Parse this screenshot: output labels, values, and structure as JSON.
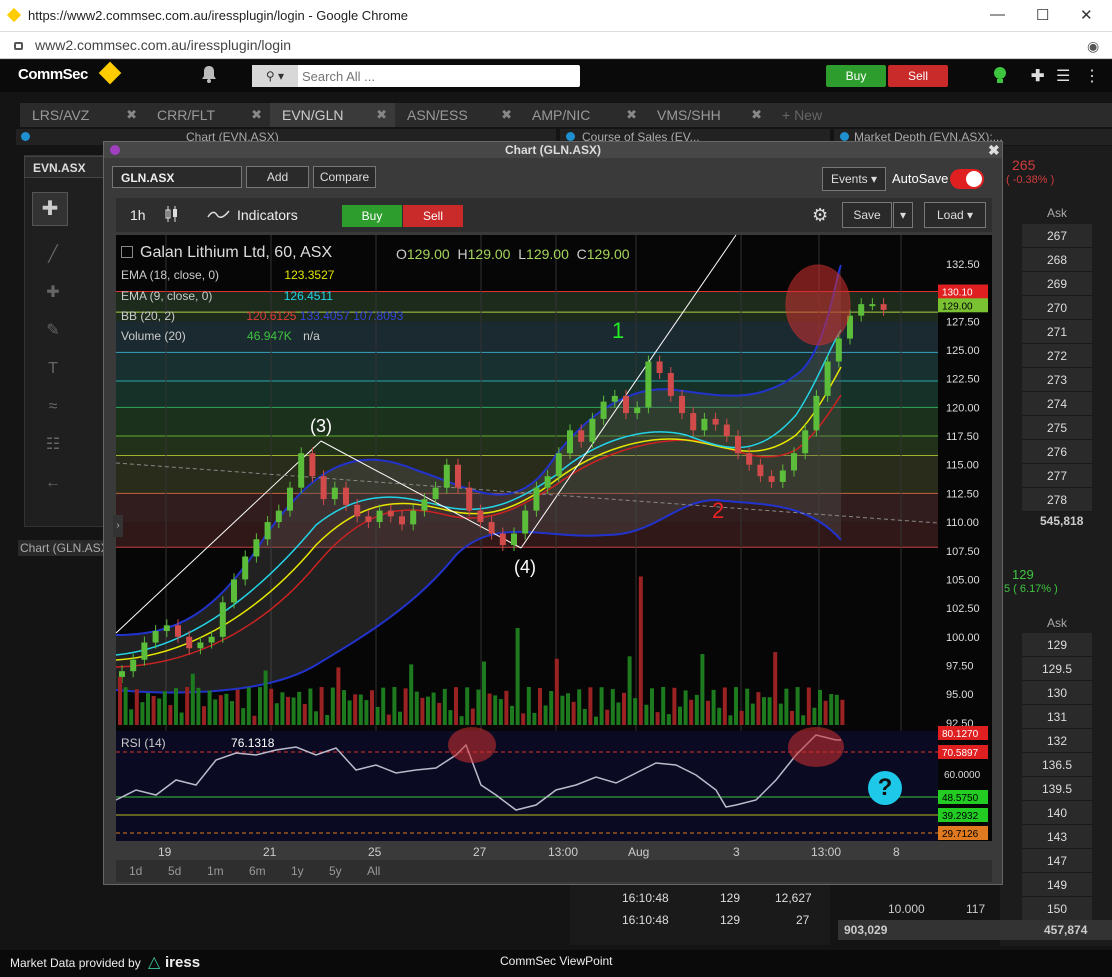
{
  "browser": {
    "title": "https://www2.commsec.com.au/iressplugin/login - Google Chrome",
    "url": "www2.commsec.com.au/iressplugin/login"
  },
  "app": {
    "logo": "CommSec",
    "search_placeholder": "Search All ...",
    "buy_label": "Buy",
    "sell_label": "Sell"
  },
  "tabs": [
    {
      "label": "LRS/AVZ"
    },
    {
      "label": "CRR/FLT"
    },
    {
      "label": "EVN/GLN"
    },
    {
      "label": "ASN/ESS"
    },
    {
      "label": "AMP/NIC"
    },
    {
      "label": "VMS/SHH"
    }
  ],
  "new_tab_label": "+ New",
  "panels": {
    "left_header": "Chart (EVN.ASX)",
    "left_symbol": "EVN.ASX",
    "left_bottom": "Chart (GLN.ASX)",
    "cos_header": "Course of Sales (EV...",
    "depth_header": "Market Depth (EVN.ASX):..."
  },
  "chart": {
    "window_title": "Chart (GLN.ASX)",
    "symbol": "GLN.ASX",
    "add_label": "Add",
    "compare_label": "Compare",
    "events_label": "Events",
    "autosave_label": "AutoSave",
    "interval": "1h",
    "indicators_label": "Indicators",
    "buy_label": "Buy",
    "sell_label": "Sell",
    "save_label": "Save",
    "load_label": "Load",
    "instrument": "Galan Lithium Ltd, 60, ASX",
    "o_label": "O",
    "o_value": "129.00",
    "h_label": "H",
    "h_value": "129.00",
    "l_label": "L",
    "l_value": "129.00",
    "c_label": "C",
    "c_value": "129.00",
    "ema18_label": "EMA (18, close, 0)",
    "ema18_value": "123.3527",
    "ema9_label": "EMA (9, close, 0)",
    "ema9_value": "126.4511",
    "bb_label": "BB (20, 2)",
    "bb_value1": "120.6125",
    "bb_value2": "133.4057",
    "bb_value3": "107.8093",
    "vol_label": "Volume (20)",
    "vol_value": "46.947K",
    "vol_na": "n/a",
    "rsi_label": "RSI (14)",
    "rsi_value": "76.1318",
    "annotations": {
      "a1": "1",
      "a2": "2",
      "a3": "(3)",
      "a4": "(4)"
    },
    "periods": [
      "1d",
      "5d",
      "1m",
      "6m",
      "1y",
      "5y",
      "All"
    ],
    "x_ticks": [
      "19",
      "21",
      "25",
      "27",
      "13:00",
      "Aug",
      "3",
      "13:00",
      "8"
    ],
    "y_ticks": [
      "132.50",
      "127.50",
      "125.00",
      "122.50",
      "120.00",
      "117.50",
      "115.00",
      "112.50",
      "110.00",
      "107.50",
      "105.00",
      "102.50",
      "100.00",
      "97.50",
      "95.00",
      "92.50"
    ],
    "price_tags": {
      "high": "130.10",
      "last": "129.00"
    },
    "rsi_ticks": {
      "t80": "80.1270",
      "t70": "70.5897",
      "t60": "60.0000",
      "t48": "48.5750",
      "t39": "39.2932",
      "t29": "29.7126"
    },
    "colors": {
      "ema18": "#e6e600",
      "ema9": "#22d3e6",
      "bb": "#2233cc",
      "bbmid": "#cc2222",
      "up": "#5bbd3a",
      "down": "#d24b4b"
    }
  },
  "market_depth": {
    "top_price": "265",
    "top_change": "( -0.38% )",
    "ask_header": "Ask",
    "asks": [
      "267",
      "268",
      "269",
      "270",
      "271",
      "272",
      "273",
      "274",
      "275",
      "276",
      "277",
      "278"
    ],
    "total": "545,818",
    "second_price": "129",
    "second_change": "5 ( 6.17% )",
    "ask_header2": "Ask",
    "asks2": [
      "129",
      "129.5",
      "130",
      "131",
      "132",
      "136.5",
      "139.5",
      "140",
      "143",
      "147",
      "149",
      "150"
    ],
    "total2": "457,874",
    "bottom_left_total": "903,029",
    "bottom_row_price": "10.000",
    "bottom_row_vol": "117"
  },
  "course_of_sales": [
    {
      "time": "16:10:48",
      "price": "129",
      "vol": "12,627"
    },
    {
      "time": "16:10:48",
      "price": "129",
      "vol": "27"
    }
  ],
  "footer": {
    "provider": "Market Data provided by",
    "brand": "iress",
    "viewpoint": "CommSec ViewPoint"
  }
}
